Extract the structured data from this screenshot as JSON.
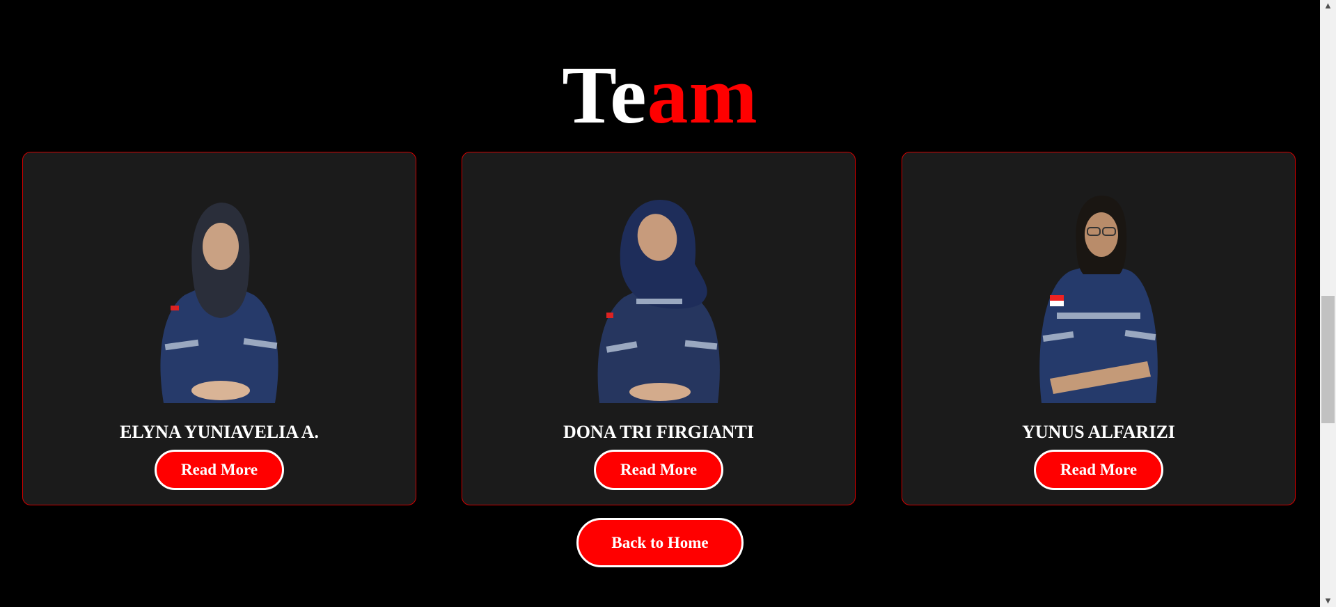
{
  "heading": {
    "part_white": "Te",
    "part_red": "am"
  },
  "team": [
    {
      "name": "ELYNA YUNIAVELIA A.",
      "button": "Read More"
    },
    {
      "name": "DONA TRI FIRGIANTI",
      "button": "Read More"
    },
    {
      "name": "YUNUS ALFARIZI",
      "button": "Read More"
    }
  ],
  "home_button": "Back to Home",
  "icons": {
    "scroll_up": "triangle-up-icon",
    "scroll_down": "triangle-down-icon"
  },
  "colors": {
    "background": "#000000",
    "card": "#1b1b1b",
    "accent": "#ff0000",
    "text": "#ffffff"
  }
}
